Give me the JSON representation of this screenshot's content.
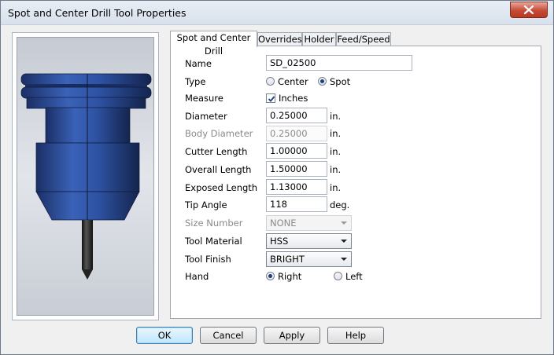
{
  "window": {
    "title": "Spot and Center Drill Tool Properties"
  },
  "tabs": [
    {
      "label": "Spot and Center Drill",
      "active": true
    },
    {
      "label": "Overrides",
      "active": false
    },
    {
      "label": "Holder",
      "active": false
    },
    {
      "label": "Feed/Speed",
      "active": false
    }
  ],
  "form": {
    "name": {
      "label": "Name",
      "value": "SD_02500"
    },
    "type": {
      "label": "Type",
      "options": [
        "Center",
        "Spot"
      ],
      "selected": "Spot"
    },
    "measure": {
      "label": "Measure",
      "checkbox_label": "Inches",
      "checked": true
    },
    "diameter": {
      "label": "Diameter",
      "value": "0.25000",
      "unit": "in."
    },
    "body_diameter": {
      "label": "Body Diameter",
      "value": "0.25000",
      "unit": "in.",
      "disabled": true
    },
    "cutter_length": {
      "label": "Cutter Length",
      "value": "1.00000",
      "unit": "in."
    },
    "overall_length": {
      "label": "Overall Length",
      "value": "1.50000",
      "unit": "in."
    },
    "exposed_length": {
      "label": "Exposed Length",
      "value": "1.13000",
      "unit": "in."
    },
    "tip_angle": {
      "label": "Tip Angle",
      "value": "118",
      "unit": "deg."
    },
    "size_number": {
      "label": "Size Number",
      "value": "NONE",
      "disabled": true
    },
    "tool_material": {
      "label": "Tool Material",
      "value": "HSS"
    },
    "tool_finish": {
      "label": "Tool Finish",
      "value": "BRIGHT"
    },
    "hand": {
      "label": "Hand",
      "options": [
        "Right",
        "Left"
      ],
      "selected": "Right"
    }
  },
  "buttons": {
    "ok": "OK",
    "cancel": "Cancel",
    "apply": "Apply",
    "help": "Help"
  },
  "colors": {
    "tool_body": "#2d4f9a",
    "tool_shank": "#2a2a2a",
    "close_button": "#c74a35",
    "preview_bg": "#d4d8de"
  }
}
